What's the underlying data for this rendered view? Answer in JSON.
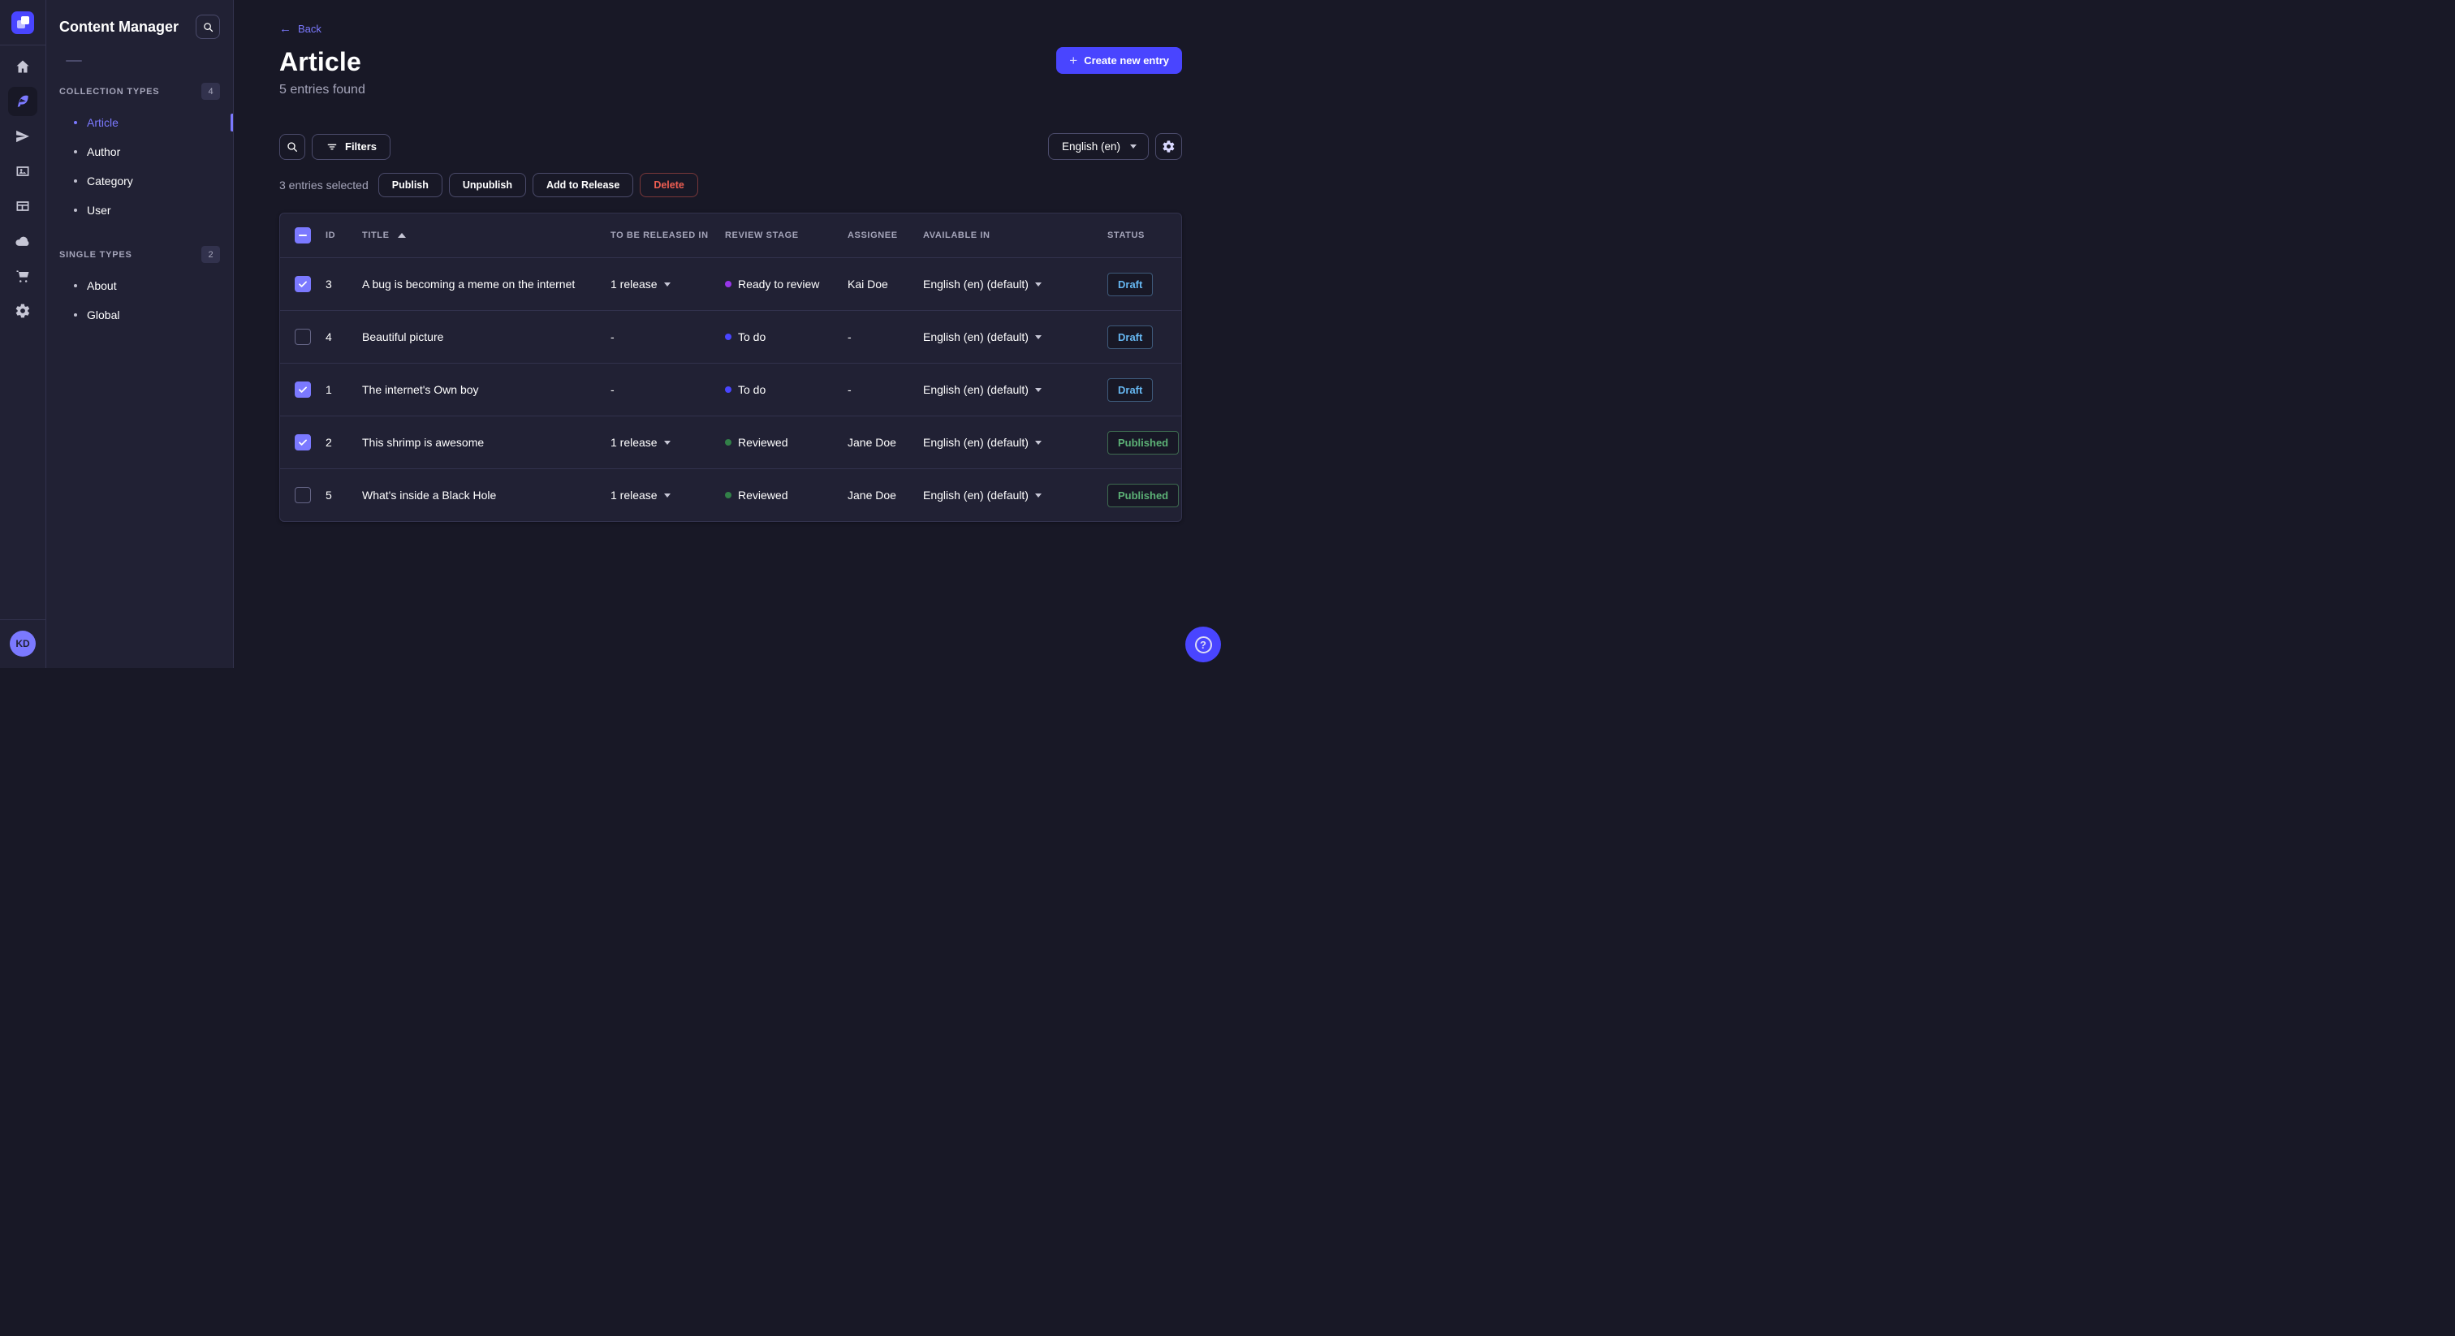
{
  "colors": {
    "primary": "#4945ff",
    "primary_light": "#7b79ff",
    "danger": "#ee5e52",
    "success": "#5cb176",
    "draft_blue": "#66b7f1"
  },
  "rail": {
    "items": [
      {
        "icon": "home-icon",
        "active": false
      },
      {
        "icon": "content-manager-icon",
        "active": true
      },
      {
        "icon": "releases-icon",
        "active": false
      },
      {
        "icon": "media-library-icon",
        "active": false
      },
      {
        "icon": "content-type-builder-icon",
        "active": false
      },
      {
        "icon": "deploy-icon",
        "active": false
      },
      {
        "icon": "marketplace-icon",
        "active": false
      },
      {
        "icon": "settings-icon",
        "active": false
      }
    ],
    "avatar_initials": "KD"
  },
  "sidebar": {
    "title": "Content Manager",
    "sections": [
      {
        "label": "COLLECTION TYPES",
        "count": "4",
        "items": [
          {
            "label": "Article",
            "active": true
          },
          {
            "label": "Author",
            "active": false
          },
          {
            "label": "Category",
            "active": false
          },
          {
            "label": "User",
            "active": false
          }
        ]
      },
      {
        "label": "SINGLE TYPES",
        "count": "2",
        "items": [
          {
            "label": "About",
            "active": false
          },
          {
            "label": "Global",
            "active": false
          }
        ]
      }
    ]
  },
  "header": {
    "back": "Back",
    "title": "Article",
    "subtitle": "5 entries found",
    "create": "Create new entry"
  },
  "toolbar": {
    "filters": "Filters",
    "locale": "English (en)"
  },
  "selection": {
    "label": "3 entries selected",
    "actions": [
      {
        "label": "Publish",
        "variant": "default"
      },
      {
        "label": "Unpublish",
        "variant": "default"
      },
      {
        "label": "Add to Release",
        "variant": "default"
      },
      {
        "label": "Delete",
        "variant": "danger"
      }
    ]
  },
  "table": {
    "select_all_state": "indeterminate",
    "sort": {
      "column": "TITLE",
      "direction": "asc"
    },
    "columns": {
      "id": "ID",
      "title": "TITLE",
      "release": "TO BE RELEASED IN",
      "review": "REVIEW STAGE",
      "assignee": "ASSIGNEE",
      "available": "AVAILABLE IN",
      "status": "STATUS"
    },
    "status_styles": {
      "Draft": {
        "color": "#66b7f1",
        "border": "#3e5a7a"
      },
      "Published": {
        "color": "#5cb176",
        "border": "#3e6b50"
      }
    },
    "rows": [
      {
        "checked": true,
        "id": "3",
        "title": "A bug is becoming a meme on the internet",
        "release": "1 release",
        "review": {
          "label": "Ready to review",
          "color": "#9736e8"
        },
        "assignee": "Kai Doe",
        "locale": "English (en) (default)",
        "status": "Draft"
      },
      {
        "checked": false,
        "id": "4",
        "title": "Beautiful picture",
        "release": "-",
        "review": {
          "label": "To do",
          "color": "#4945ff"
        },
        "assignee": "-",
        "locale": "English (en) (default)",
        "status": "Draft"
      },
      {
        "checked": true,
        "id": "1",
        "title": "The internet's Own boy",
        "release": "-",
        "review": {
          "label": "To do",
          "color": "#4945ff"
        },
        "assignee": "-",
        "locale": "English (en) (default)",
        "status": "Draft"
      },
      {
        "checked": true,
        "id": "2",
        "title": "This shrimp is awesome",
        "release": "1 release",
        "review": {
          "label": "Reviewed",
          "color": "#328048"
        },
        "assignee": "Jane Doe",
        "locale": "English (en) (default)",
        "status": "Published"
      },
      {
        "checked": false,
        "id": "5",
        "title": "What's inside a Black Hole",
        "release": "1 release",
        "review": {
          "label": "Reviewed",
          "color": "#328048"
        },
        "assignee": "Jane Doe",
        "locale": "English (en) (default)",
        "status": "Published"
      }
    ]
  },
  "help": {
    "glyph": "?"
  }
}
